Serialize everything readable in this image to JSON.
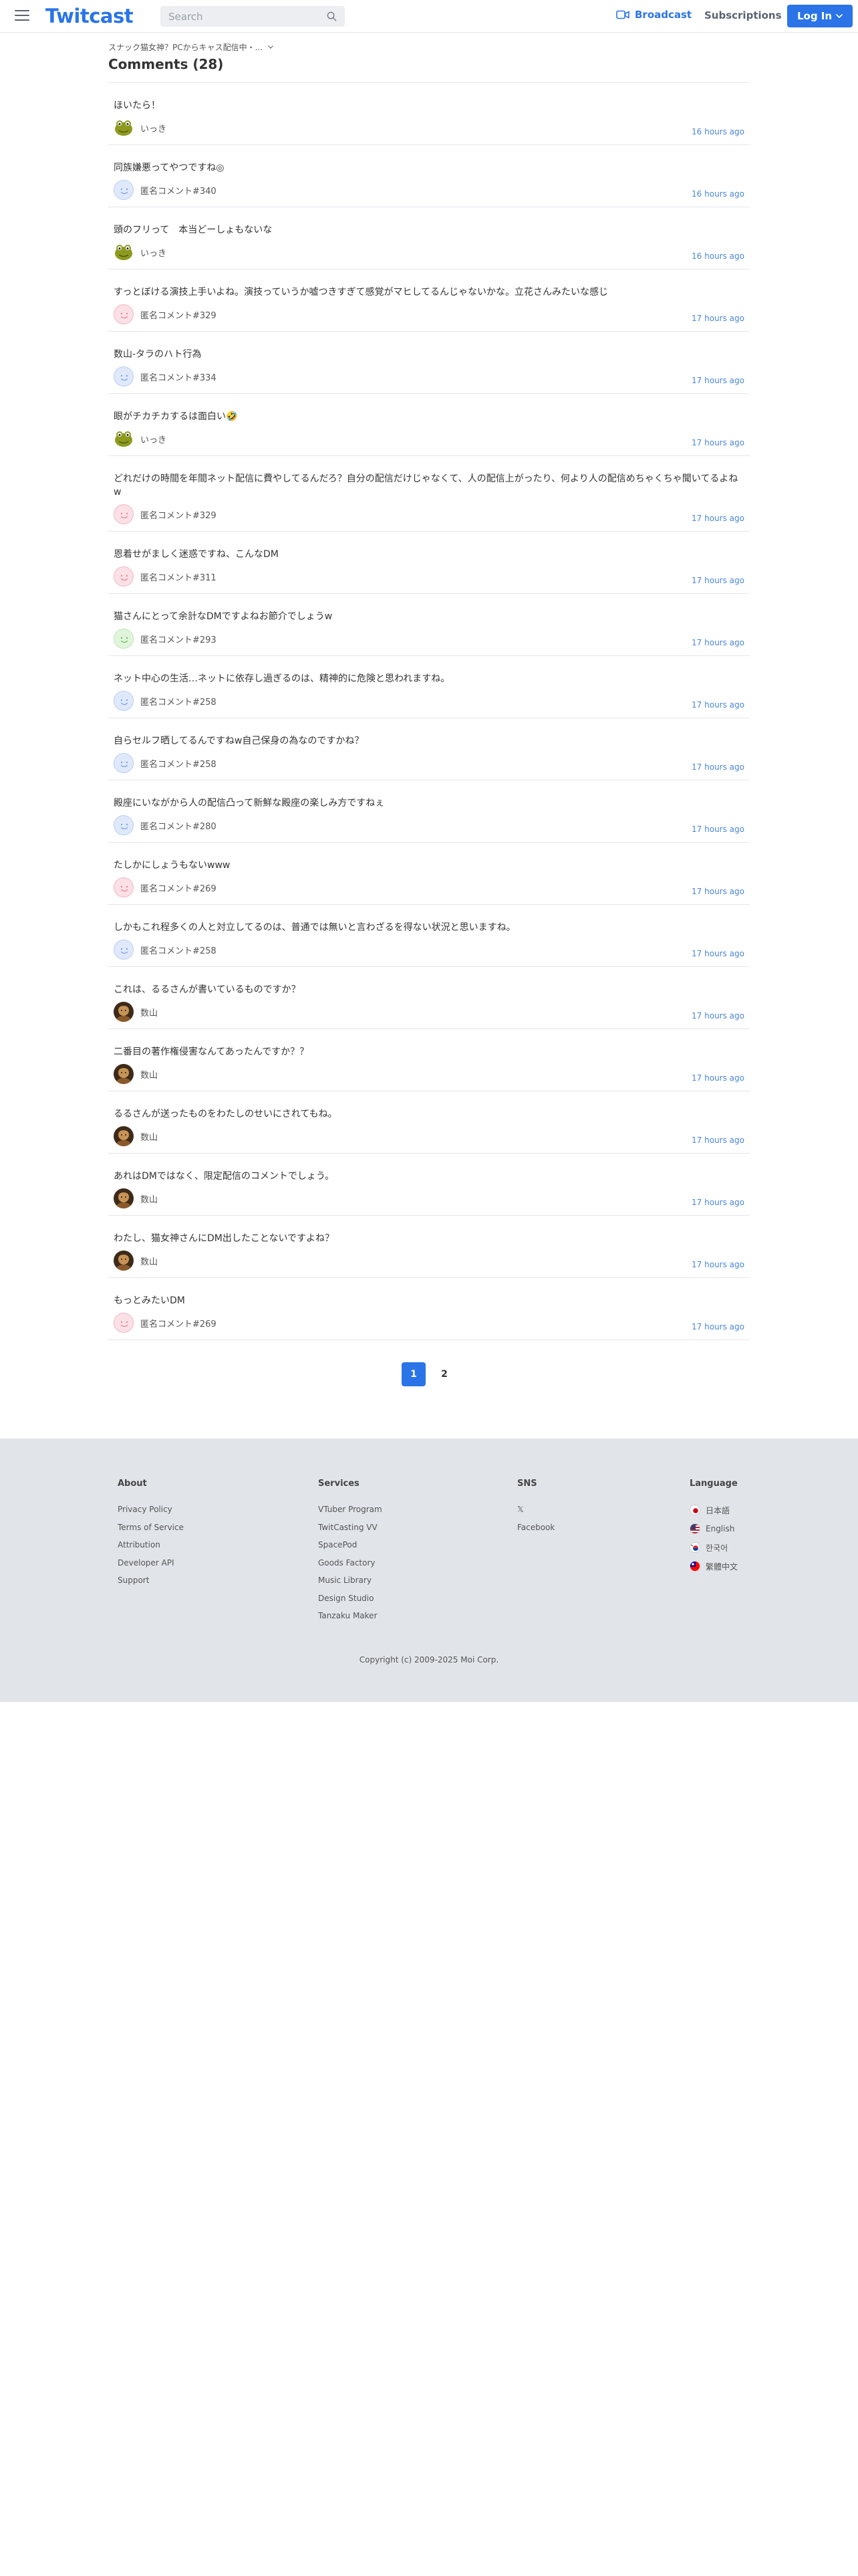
{
  "header": {
    "logo": "Twitcast",
    "search_placeholder": "Search",
    "broadcast_label": "Broadcast",
    "subscriptions_label": "Subscriptions",
    "login_label": "Log In"
  },
  "main": {
    "breadcrumb": "スナック猫女神？PCからキャス配信中・...",
    "title": "Comments (28)"
  },
  "comments": [
    {
      "text": "ほいたら！",
      "user": "いっき",
      "avatar": "frog",
      "time": "16 hours ago"
    },
    {
      "text": "同族嫌悪ってやつですね◎",
      "user": "匿名コメント#340",
      "avatar": "blue",
      "time": "16 hours ago"
    },
    {
      "text": "頭のフリって　本当どーしょもないな",
      "user": "いっき",
      "avatar": "frog",
      "time": "16 hours ago"
    },
    {
      "text": "すっとぼける演技上手いよね。演技っていうか嘘つきすぎて感覚がマヒしてるんじゃないかな。立花さんみたいな感じ",
      "user": "匿名コメント#329",
      "avatar": "pink",
      "time": "17 hours ago"
    },
    {
      "text": "数山-タラのハト行為",
      "user": "匿名コメント#334",
      "avatar": "blue",
      "time": "17 hours ago"
    },
    {
      "text": "眼がチカチカするは面白い🤣",
      "user": "いっき",
      "avatar": "frog",
      "time": "17 hours ago"
    },
    {
      "text": "どれだけの時間を年間ネット配信に費やしてるんだろ？自分の配信だけじゃなくて、人の配信上がったり、何より人の配信めちゃくちゃ聞いてるよねw",
      "user": "匿名コメント#329",
      "avatar": "pink",
      "time": "17 hours ago",
      "tall": true
    },
    {
      "text": "恩着せがましく迷惑ですね、こんなDM",
      "user": "匿名コメント#311",
      "avatar": "pink",
      "time": "17 hours ago"
    },
    {
      "text": "猫さんにとって余計なDMですよねお節介でしょうw",
      "user": "匿名コメント#293",
      "avatar": "green",
      "time": "17 hours ago"
    },
    {
      "text": "ネット中心の生活…ネットに依存し過ぎるのは、精神的に危険と思われますね。",
      "user": "匿名コメント#258",
      "avatar": "blue",
      "time": "17 hours ago"
    },
    {
      "text": "自らセルフ晒してるんですねw自己保身の為なのですかね？",
      "user": "匿名コメント#258",
      "avatar": "blue",
      "time": "17 hours ago"
    },
    {
      "text": "殿座にいながから人の配信凸って新鮮な殿座の楽しみ方ですねぇ",
      "user": "匿名コメント#280",
      "avatar": "blue",
      "time": "17 hours ago"
    },
    {
      "text": "たしかにしょうもないwww",
      "user": "匿名コメント#269",
      "avatar": "pink",
      "time": "17 hours ago"
    },
    {
      "text": "しかもこれ程多くの人と対立してるのは、普通では無いと言わざるを得ない状況と思いますね。",
      "user": "匿名コメント#258",
      "avatar": "blue",
      "time": "17 hours ago"
    },
    {
      "text": "これは、るるさんが書いているものですか？",
      "user": "数山",
      "avatar": "photo",
      "time": "17 hours ago"
    },
    {
      "text": "二番目の著作権侵害なんてあったんですか？？",
      "user": "数山",
      "avatar": "photo",
      "time": "17 hours ago"
    },
    {
      "text": "るるさんが送ったものをわたしのせいにされてもね。",
      "user": "数山",
      "avatar": "photo",
      "time": "17 hours ago"
    },
    {
      "text": "あれはDMではなく、限定配信のコメントでしょう。",
      "user": "数山",
      "avatar": "photo",
      "time": "17 hours ago"
    },
    {
      "text": "わたし、猫女神さんにDM出したことないですよね？",
      "user": "数山",
      "avatar": "photo",
      "time": "17 hours ago"
    },
    {
      "text": "もっとみたいDM",
      "user": "匿名コメント#269",
      "avatar": "pink",
      "time": "17 hours ago"
    }
  ],
  "pagination": {
    "pages": [
      "1",
      "2"
    ],
    "current": "1"
  },
  "footer": {
    "about": {
      "heading": "About",
      "links": [
        "Privacy Policy",
        "Terms of Service",
        "Attribution",
        "Developer API",
        "Support"
      ]
    },
    "services": {
      "heading": "Services",
      "links": [
        "VTuber Program",
        "TwitCasting VV",
        "SpacePod",
        "Goods Factory",
        "Music Library",
        "Design Studio",
        "Tanzaku Maker"
      ]
    },
    "sns": {
      "heading": "SNS",
      "links": [
        "𝕏",
        "Facebook"
      ]
    },
    "language": {
      "heading": "Language",
      "items": [
        {
          "label": "日本語",
          "flag": "jp"
        },
        {
          "label": "English",
          "flag": "us"
        },
        {
          "label": "한국어",
          "flag": "kr"
        },
        {
          "label": "繁體中文",
          "flag": "tw"
        }
      ]
    },
    "copyright": "Copyright (c) 2009-2025 Moi Corp."
  },
  "colors": {
    "accent": "#2a74e8",
    "timestamp": "#4a86d8",
    "footer_bg": "#e1e4e8"
  },
  "icons": {
    "menu": "hamburger-icon",
    "search": "search-icon",
    "broadcast": "camera-icon",
    "login_caret": "chevron-down-icon"
  }
}
